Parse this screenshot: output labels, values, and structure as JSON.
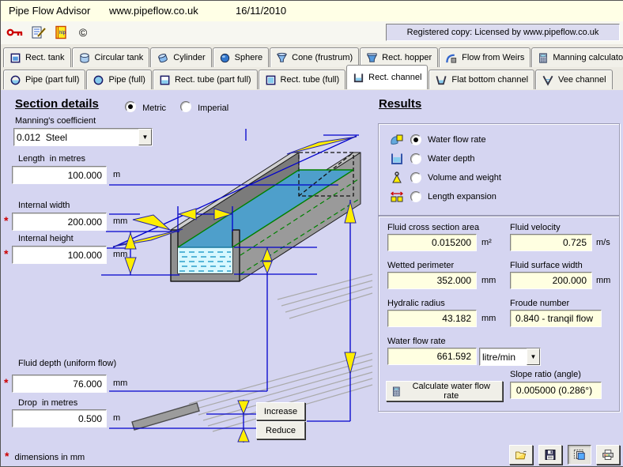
{
  "window": {
    "app_title": "Pipe Flow Advisor",
    "site": "www.pipeflow.co.uk",
    "date": "16/11/2010"
  },
  "toolbar": {
    "registered": "Registered copy: Licensed by www.pipeflow.co.uk",
    "icons": [
      "key-icon",
      "register-notepad-icon",
      "help-book-icon",
      "copyright-icon"
    ],
    "copyright_glyph": "©"
  },
  "tabs": {
    "active": "Rect. channel",
    "row1": [
      {
        "label": "Rect. tank"
      },
      {
        "label": "Circular tank"
      },
      {
        "label": "Cylinder"
      },
      {
        "label": "Sphere"
      },
      {
        "label": "Cone (frustrum)"
      },
      {
        "label": "Rect. hopper"
      },
      {
        "label": "Flow from Weirs"
      },
      {
        "label": "Manning calculator"
      }
    ],
    "row2": [
      {
        "label": "Pipe (part full)"
      },
      {
        "label": "Pipe (full)"
      },
      {
        "label": "Rect. tube (part full)"
      },
      {
        "label": "Rect. tube (full)"
      },
      {
        "label": "Rect. channel"
      },
      {
        "label": "Flat bottom channel"
      },
      {
        "label": "Vee channel"
      }
    ]
  },
  "section": {
    "heading": "Section details",
    "metric_label": "Metric",
    "imperial_label": "Imperial",
    "manning_label": "Manning's coefficient",
    "manning_value": "0.012  Steel",
    "length": {
      "label": "Length  in metres",
      "value": "100.000",
      "unit": "m"
    },
    "width": {
      "label": "Internal width",
      "value": "200.000",
      "unit": "mm"
    },
    "height": {
      "label": "Internal height",
      "value": "100.000",
      "unit": "mm"
    },
    "depth": {
      "label": "Fluid depth (uniform flow)",
      "value": "76.000",
      "unit": "mm"
    },
    "drop": {
      "label": "Drop  in metres",
      "value": "0.500",
      "unit": "m"
    },
    "increase_label": "Increase",
    "reduce_label": "Reduce",
    "required_marker": "*",
    "footnote": "dimensions in mm"
  },
  "results": {
    "heading": "Results",
    "options": [
      {
        "label": "Water flow rate",
        "selected": true
      },
      {
        "label": "Water depth",
        "selected": false
      },
      {
        "label": "Volume and weight",
        "selected": false
      },
      {
        "label": "Length expansion",
        "selected": false
      }
    ],
    "cross_area": {
      "label": "Fluid cross section area",
      "value": "0.015200",
      "unit": "m²"
    },
    "velocity": {
      "label": "Fluid velocity",
      "value": "0.725",
      "unit": "m/s"
    },
    "wetted": {
      "label": "Wetted perimeter",
      "value": "352.000",
      "unit": "mm"
    },
    "surface_width": {
      "label": "Fluid surface width",
      "value": "200.000",
      "unit": "mm"
    },
    "hyd_radius": {
      "label": "Hydralic radius",
      "value": "43.182",
      "unit": "mm"
    },
    "froude": {
      "label": "Froude number",
      "value": "0.840 - tranqil flow"
    },
    "flow_rate": {
      "label": "Water flow rate",
      "value": "661.592",
      "unit_selected": "litre/min"
    },
    "calc_label": "Calculate water flow rate",
    "slope": {
      "label": "Slope ratio (angle)",
      "value": "0.005000 (0.286°)"
    }
  },
  "colors": {
    "main_bg": "#d5d5f1",
    "titlebar_bg": "#ffffe6",
    "result_field_bg": "#ffffe1",
    "required_marker": "#cc0000",
    "dimension_line": "#0000cc",
    "arrow_fill": "#ffee00",
    "water_surface": "#4e9fcb",
    "water_front": "#d8f8ff",
    "channel_gray": "#9a9a9a"
  }
}
